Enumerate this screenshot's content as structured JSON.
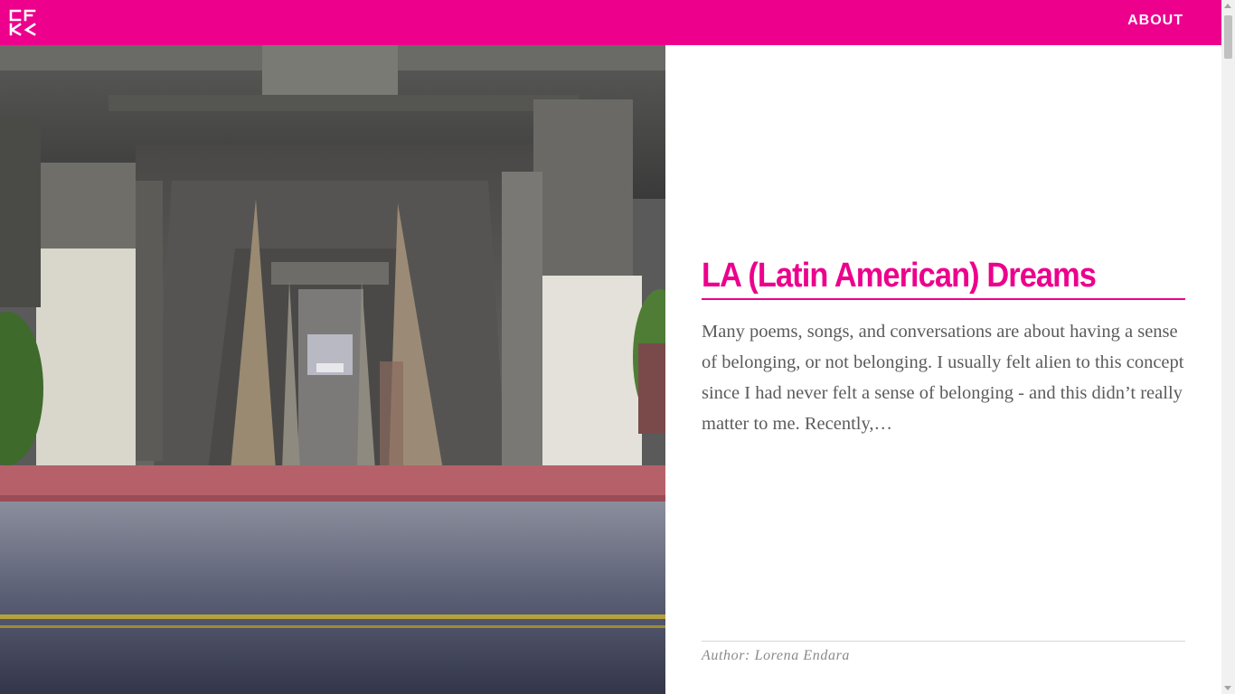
{
  "header": {
    "logo_icon": "cfk-monogram-logo",
    "nav": {
      "about_label": "ABOUT"
    },
    "background_color": "#ec008c"
  },
  "feature_image": {
    "subject": "concrete-overpass-underside-street-photo"
  },
  "post": {
    "title": "LA (Latin American) Dreams",
    "excerpt": "Many poems, songs, and conversations are about having a sense of belonging, or not belonging. I usually felt alien to this concept since I had never felt a sense of belonging - and this didn’t really matter to me. Recently,…",
    "author_line": "Author: Lorena Endara",
    "accent_color": "#ec008c"
  }
}
